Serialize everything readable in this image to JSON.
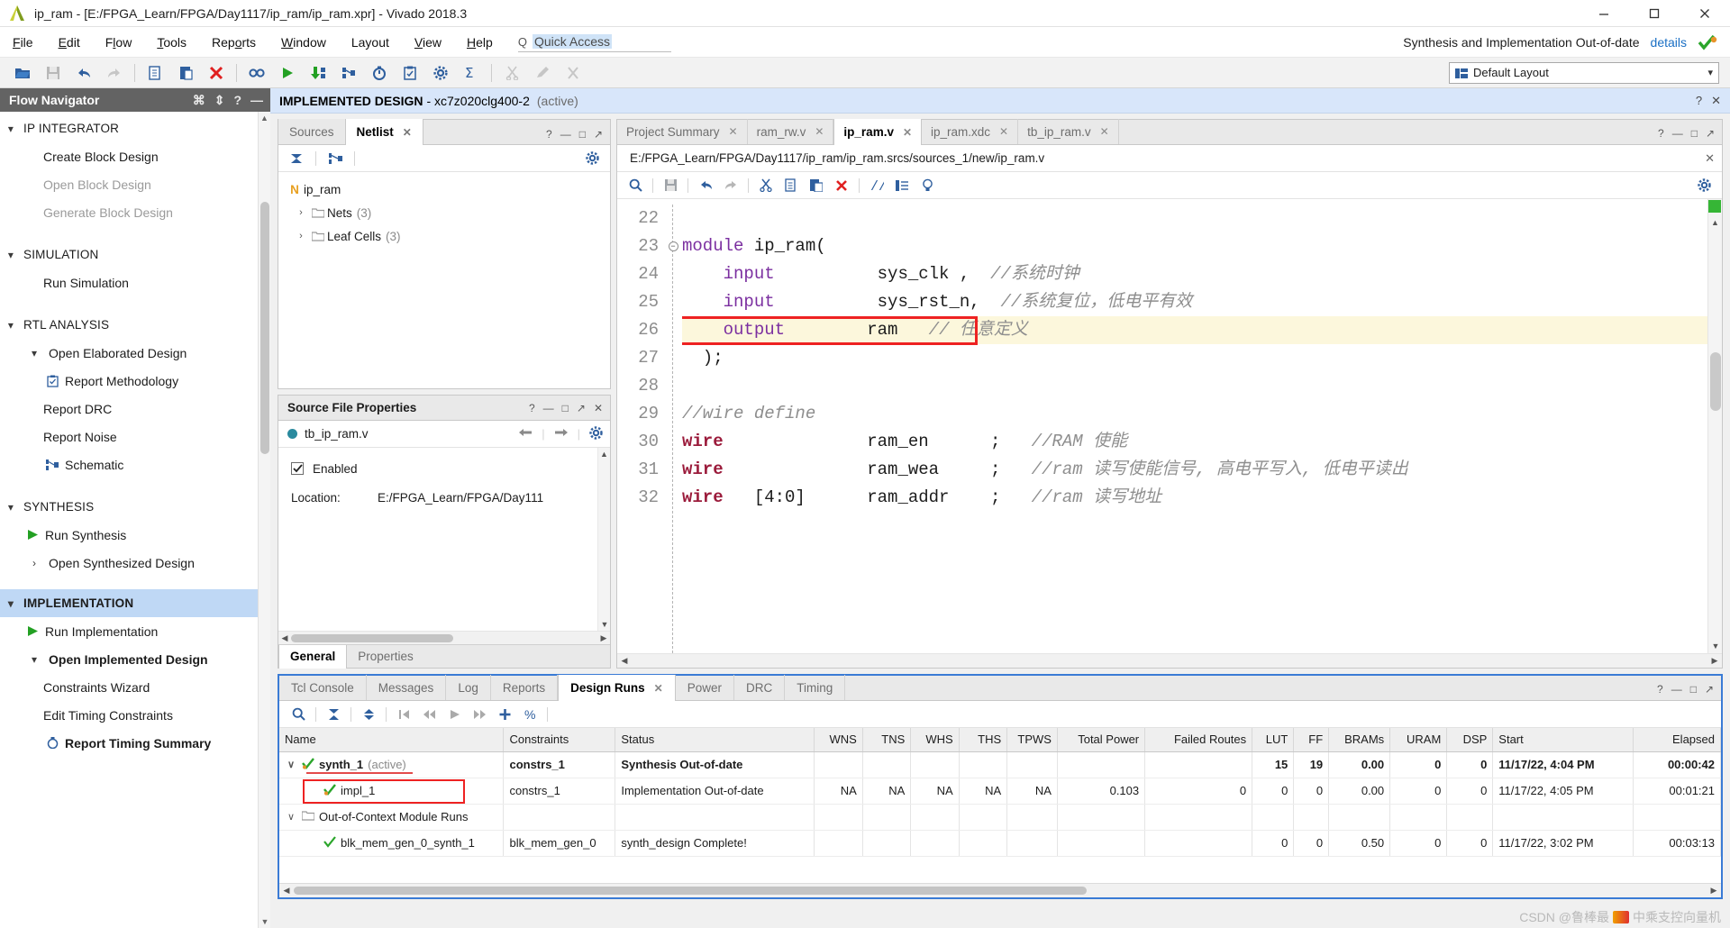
{
  "window": {
    "title": "ip_ram - [E:/FPGA_Learn/FPGA/Day1117/ip_ram/ip_ram.xpr] - Vivado 2018.3",
    "minimize": "minimize-icon",
    "maximize": "maximize-icon",
    "close": "close-icon"
  },
  "menubar": {
    "items": [
      "File",
      "Edit",
      "Flow",
      "Tools",
      "Reports",
      "Window",
      "Layout",
      "View",
      "Help"
    ],
    "quick_access_placeholder": "Quick Access",
    "quick_access_value": "Quick Access",
    "status_message": "Synthesis and Implementation Out-of-date",
    "details_link": "details"
  },
  "toolbar": {
    "layout_label": "Default Layout",
    "buttons": [
      "open-project",
      "save",
      "undo",
      "redo",
      "copy",
      "paste",
      "delete",
      "find",
      "run",
      "download-bitstream",
      "schematic",
      "timing",
      "report",
      "settings",
      "sum",
      "cut-disabled",
      "edit-disabled",
      "close-disabled"
    ]
  },
  "flow_navigator": {
    "title": "Flow Navigator",
    "sections": [
      {
        "label": "IP INTEGRATOR",
        "items": [
          {
            "label": "Create Block Design",
            "dim": false
          },
          {
            "label": "Open Block Design",
            "dim": true
          },
          {
            "label": "Generate Block Design",
            "dim": true
          }
        ]
      },
      {
        "label": "SIMULATION",
        "items": [
          {
            "label": "Run Simulation",
            "dim": false
          }
        ]
      },
      {
        "label": "RTL ANALYSIS",
        "items": [
          {
            "label": "Open Elaborated Design",
            "dim": false
          },
          {
            "label": "Report Methodology",
            "dim": false
          },
          {
            "label": "Report DRC",
            "dim": false
          },
          {
            "label": "Report Noise",
            "dim": false
          },
          {
            "label": "Schematic",
            "dim": false
          }
        ]
      },
      {
        "label": "SYNTHESIS",
        "items": [
          {
            "label": "Run Synthesis",
            "dim": false
          },
          {
            "label": "Open Synthesized Design",
            "dim": false
          }
        ]
      },
      {
        "label": "IMPLEMENTATION",
        "highlighted": true,
        "items": [
          {
            "label": "Run Implementation",
            "dim": false
          },
          {
            "label": "Open Implemented Design",
            "dim": false
          },
          {
            "label": "Constraints Wizard",
            "dim": false
          },
          {
            "label": "Edit Timing Constraints",
            "dim": false
          },
          {
            "label": "Report Timing Summary",
            "dim": false
          }
        ]
      }
    ]
  },
  "design_header": {
    "title": "IMPLEMENTED DESIGN",
    "device": "- xc7z020clg400-2",
    "state": "(active)"
  },
  "netlist_panel": {
    "tabs": [
      {
        "label": "Sources",
        "active": false,
        "closable": false
      },
      {
        "label": "Netlist",
        "active": true,
        "closable": true
      }
    ],
    "tree": [
      {
        "label": "ip_ram",
        "icon": "N",
        "count": "",
        "level": 0,
        "chevron": ""
      },
      {
        "label": "Nets",
        "icon": "folder",
        "count": "(3)",
        "level": 1,
        "chevron": "›"
      },
      {
        "label": "Leaf Cells",
        "icon": "folder",
        "count": "(3)",
        "level": 1,
        "chevron": "›"
      }
    ]
  },
  "source_properties": {
    "title": "Source File Properties",
    "file_name": "tb_ip_ram.v",
    "enabled_label": "Enabled",
    "enabled_checked": true,
    "location_label": "Location:",
    "location_value": "E:/FPGA_Learn/FPGA/Day111",
    "tabs": [
      {
        "label": "General",
        "active": true
      },
      {
        "label": "Properties",
        "active": false
      }
    ]
  },
  "editor": {
    "tabs": [
      {
        "label": "Project Summary",
        "active": false,
        "closable": true
      },
      {
        "label": "ram_rw.v",
        "active": false,
        "closable": true
      },
      {
        "label": "ip_ram.v",
        "active": true,
        "closable": true
      },
      {
        "label": "ip_ram.xdc",
        "active": false,
        "closable": true
      },
      {
        "label": "tb_ip_ram.v",
        "active": false,
        "closable": true
      }
    ],
    "file_path": "E:/FPGA_Learn/FPGA/Day1117/ip_ram/ip_ram.srcs/sources_1/new/ip_ram.v",
    "toolbar_buttons": [
      "find-icon",
      "save-icon",
      "undo-icon",
      "redo-icon",
      "cut-icon",
      "copy-icon",
      "paste-icon",
      "delete-icon",
      "comment-icon",
      "indent-icon",
      "bulb-icon",
      "settings-icon"
    ],
    "lines": [
      {
        "num": "22",
        "fold": "",
        "highlight": false,
        "segments": []
      },
      {
        "num": "23",
        "fold": "minus",
        "highlight": false,
        "segments": [
          {
            "t": "module",
            "c": "kw"
          },
          {
            "t": " ip_ram(",
            "c": "pl"
          }
        ]
      },
      {
        "num": "24",
        "fold": "",
        "highlight": false,
        "segments": [
          {
            "t": "    ",
            "c": "pl"
          },
          {
            "t": "input",
            "c": "kw"
          },
          {
            "t": "          sys_clk ,  ",
            "c": "pl"
          },
          {
            "t": "//系统时钟",
            "c": "cm"
          }
        ]
      },
      {
        "num": "25",
        "fold": "",
        "highlight": false,
        "segments": [
          {
            "t": "    ",
            "c": "pl"
          },
          {
            "t": "input",
            "c": "kw"
          },
          {
            "t": "          sys_rst_n,  ",
            "c": "pl"
          },
          {
            "t": "//系统复位，低电平有效",
            "c": "cm"
          }
        ]
      },
      {
        "num": "26",
        "fold": "",
        "highlight": true,
        "segments": [
          {
            "t": "    ",
            "c": "pl"
          },
          {
            "t": "output",
            "c": "kw"
          },
          {
            "t": "        ram   ",
            "c": "pl"
          },
          {
            "t": "// 任意定义",
            "c": "cm"
          }
        ]
      },
      {
        "num": "27",
        "fold": "",
        "highlight": false,
        "segments": [
          {
            "t": "  );",
            "c": "pl"
          }
        ]
      },
      {
        "num": "28",
        "fold": "",
        "highlight": false,
        "segments": []
      },
      {
        "num": "29",
        "fold": "",
        "highlight": false,
        "segments": [
          {
            "t": "//wire define",
            "c": "cm"
          }
        ]
      },
      {
        "num": "30",
        "fold": "",
        "highlight": false,
        "segments": [
          {
            "t": "wire",
            "c": "kw2"
          },
          {
            "t": "              ram_en      ;   ",
            "c": "pl"
          },
          {
            "t": "//RAM 使能",
            "c": "cm"
          }
        ]
      },
      {
        "num": "31",
        "fold": "",
        "highlight": false,
        "segments": [
          {
            "t": "wire",
            "c": "kw2"
          },
          {
            "t": "              ram_wea     ;   ",
            "c": "pl"
          },
          {
            "t": "//ram 读写使能信号, 高电平写入, 低电平读出",
            "c": "cm"
          }
        ]
      },
      {
        "num": "32",
        "fold": "",
        "highlight": false,
        "segments": [
          {
            "t": "wire",
            "c": "kw2"
          },
          {
            "t": "   [4:0]      ram_addr    ;   ",
            "c": "pl"
          },
          {
            "t": "//ram 读写地址",
            "c": "cm"
          }
        ]
      }
    ]
  },
  "dock": {
    "tabs": [
      {
        "label": "Tcl Console",
        "active": false,
        "closable": false
      },
      {
        "label": "Messages",
        "active": false,
        "closable": false
      },
      {
        "label": "Log",
        "active": false,
        "closable": false
      },
      {
        "label": "Reports",
        "active": false,
        "closable": false
      },
      {
        "label": "Design Runs",
        "active": true,
        "closable": true
      },
      {
        "label": "Power",
        "active": false,
        "closable": false
      },
      {
        "label": "DRC",
        "active": false,
        "closable": false
      },
      {
        "label": "Timing",
        "active": false,
        "closable": false
      }
    ],
    "toolbar_buttons": [
      "search-icon",
      "collapse-all-icon",
      "expand-all-icon",
      "first-icon",
      "prev-icon",
      "run-icon",
      "next-icon",
      "add-icon",
      "percent-icon"
    ],
    "columns": [
      "Name",
      "Constraints",
      "Status",
      "WNS",
      "TNS",
      "WHS",
      "THS",
      "TPWS",
      "Total Power",
      "Failed Routes",
      "LUT",
      "FF",
      "BRAMs",
      "URAM",
      "DSP",
      "Start",
      "Elapsed"
    ],
    "rows": [
      {
        "name": "synth_1",
        "suffix": "(active)",
        "icon": "check-orange",
        "chevron": "∨",
        "indent": 0,
        "bold": true,
        "redbox": false,
        "underline": true,
        "cells": {
          "Constraints": "constrs_1",
          "Status": "Synthesis Out-of-date",
          "WNS": "",
          "TNS": "",
          "WHS": "",
          "THS": "",
          "TPWS": "",
          "Total Power": "",
          "Failed Routes": "",
          "LUT": "15",
          "FF": "19",
          "BRAMs": "0.00",
          "URAM": "0",
          "DSP": "0",
          "Start": "11/17/22, 4:04 PM",
          "Elapsed": "00:00:42"
        }
      },
      {
        "name": "impl_1",
        "suffix": "",
        "icon": "check-orange",
        "chevron": "",
        "indent": 1,
        "bold": false,
        "redbox": true,
        "underline": false,
        "cells": {
          "Constraints": "constrs_1",
          "Status": "Implementation Out-of-date",
          "WNS": "NA",
          "TNS": "NA",
          "WHS": "NA",
          "THS": "NA",
          "TPWS": "NA",
          "Total Power": "0.103",
          "Failed Routes": "0",
          "LUT": "0",
          "FF": "0",
          "BRAMs": "0.00",
          "URAM": "0",
          "DSP": "0",
          "Start": "11/17/22, 4:05 PM",
          "Elapsed": "00:01:21"
        }
      },
      {
        "name": "Out-of-Context Module Runs",
        "suffix": "",
        "icon": "folder",
        "chevron": "∨",
        "indent": 0,
        "bold": false,
        "redbox": false,
        "underline": false,
        "cells": {
          "Constraints": "",
          "Status": "",
          "WNS": "",
          "TNS": "",
          "WHS": "",
          "THS": "",
          "TPWS": "",
          "Total Power": "",
          "Failed Routes": "",
          "LUT": "",
          "FF": "",
          "BRAMs": "",
          "URAM": "",
          "DSP": "",
          "Start": "",
          "Elapsed": ""
        }
      },
      {
        "name": "blk_mem_gen_0_synth_1",
        "suffix": "",
        "icon": "check-green",
        "chevron": "",
        "indent": 1,
        "bold": false,
        "redbox": false,
        "underline": false,
        "cells": {
          "Constraints": "blk_mem_gen_0",
          "Status": "synth_design Complete!",
          "WNS": "",
          "TNS": "",
          "WHS": "",
          "THS": "",
          "TPWS": "",
          "Total Power": "",
          "Failed Routes": "",
          "LUT": "0",
          "FF": "0",
          "BRAMs": "0.50",
          "URAM": "0",
          "DSP": "0",
          "Start": "11/17/22, 3:02 PM",
          "Elapsed": "00:03:13"
        }
      }
    ]
  },
  "watermark": {
    "text": "CSDN @鲁棒最",
    "suffix": "中乘支控向量机"
  }
}
